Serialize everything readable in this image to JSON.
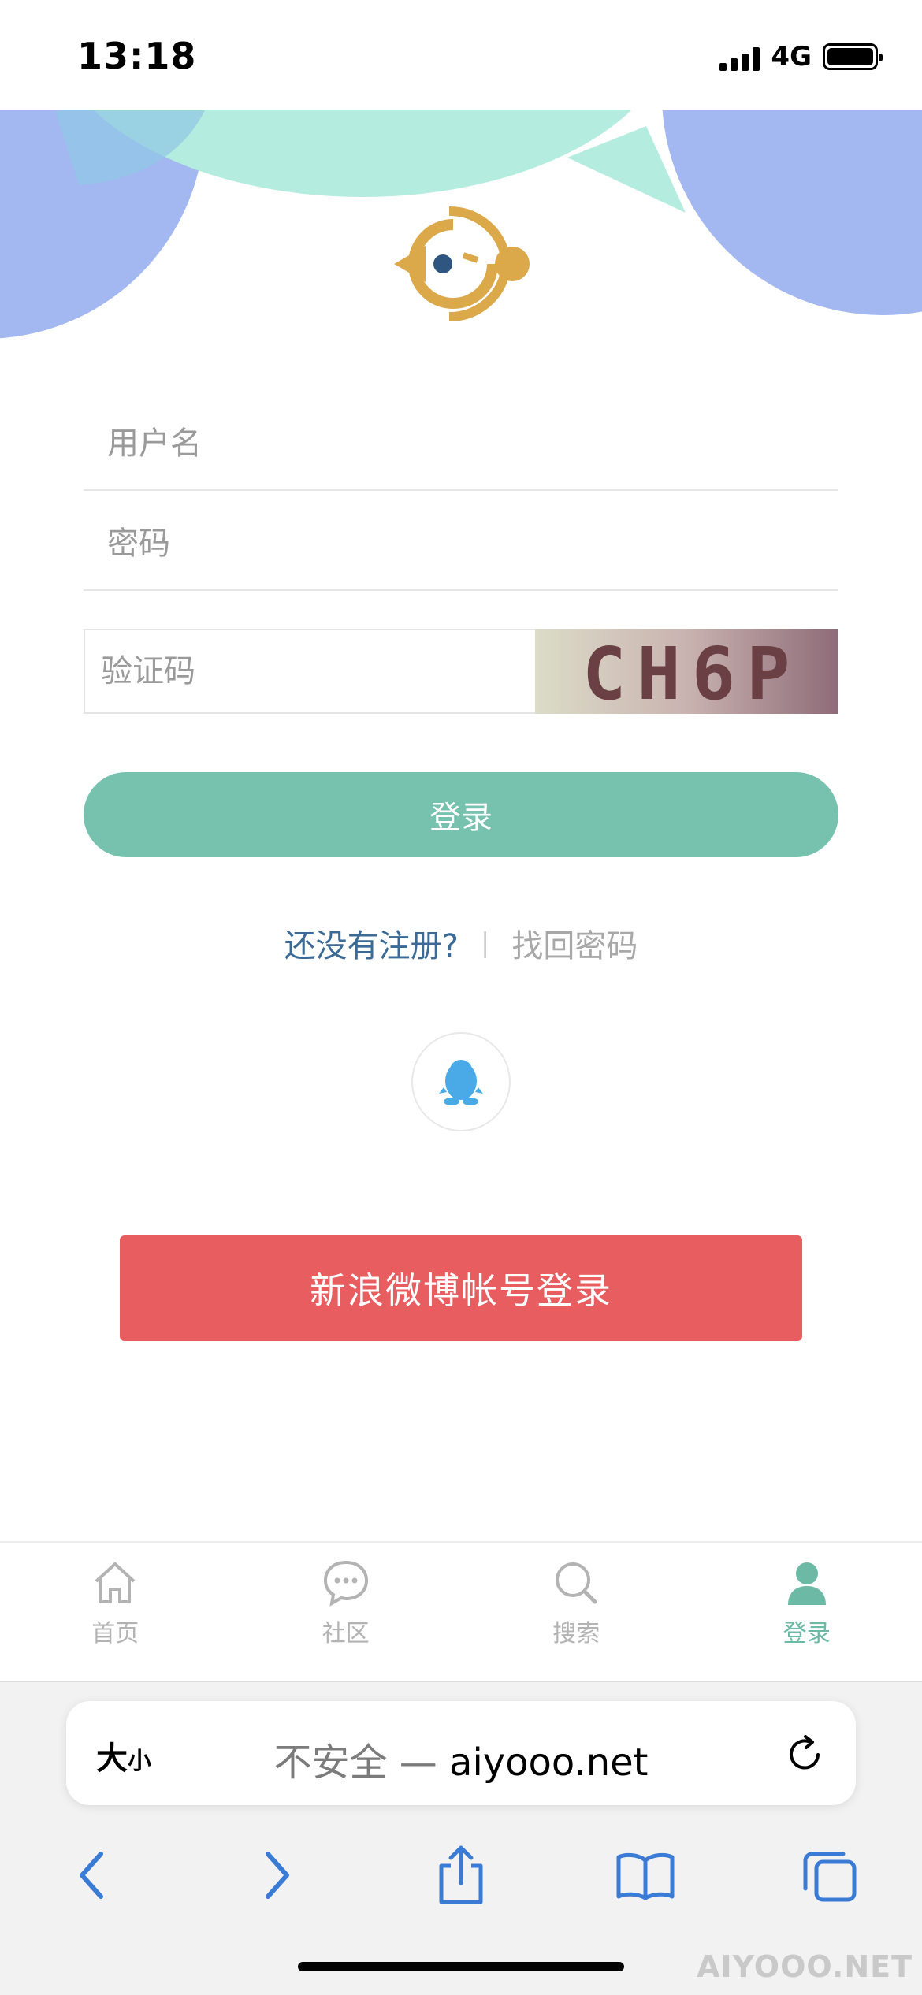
{
  "status_bar": {
    "time": "13:18",
    "network": "4G"
  },
  "form": {
    "username_placeholder": "用户名",
    "password_placeholder": "密码",
    "captcha_placeholder": "验证码",
    "captcha_code": "CH6P",
    "login_label": "登录"
  },
  "links": {
    "register": "还没有注册?",
    "separator": "|",
    "forgot_password": "找回密码"
  },
  "social": {
    "qq_icon": "qq-penguin-icon",
    "weibo_label": "新浪微博帐号登录"
  },
  "tabs": [
    {
      "label": "首页",
      "icon": "home-icon",
      "active": false
    },
    {
      "label": "社区",
      "icon": "chat-bubble-icon",
      "active": false
    },
    {
      "label": "搜索",
      "icon": "search-icon",
      "active": false
    },
    {
      "label": "登录",
      "icon": "user-icon",
      "active": true
    }
  ],
  "browser": {
    "text_size_big": "大",
    "text_size_small": "小",
    "insecure_label": "不安全 —",
    "domain": "aiyooo.net"
  },
  "watermark": "AIYOOO.NET",
  "colors": {
    "accent": "#76c2ae",
    "weibo_red": "#e85d60",
    "link_blue": "#3a6a95",
    "logo_gold": "#dba84a",
    "logo_navy": "#2e5680",
    "browser_blue": "#3a7bd5"
  }
}
